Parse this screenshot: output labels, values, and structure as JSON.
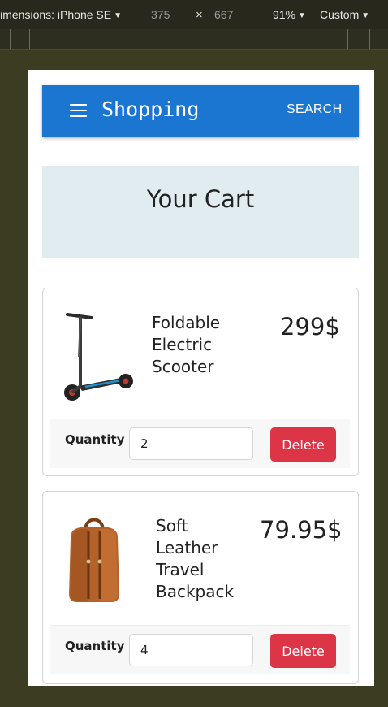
{
  "devtools": {
    "dimensions_label": "Dimensions: iPhone SE",
    "width": "375",
    "times": "×",
    "height": "667",
    "zoom": "91%",
    "mode": "Custom"
  },
  "appbar": {
    "title": "Shopping",
    "search_placeholder": "",
    "search_label": "SEARCH"
  },
  "cart": {
    "heading": "Your Cart",
    "quantity_label": "Quantity",
    "delete_label": "Delete",
    "items": [
      {
        "name": "Foldable Electric Scooter",
        "price": "299$",
        "quantity": "2",
        "image": "electric-scooter"
      },
      {
        "name": "Soft Leather Travel Backpack",
        "price": "79.95$",
        "quantity": "4",
        "image": "leather-backpack"
      }
    ]
  },
  "colors": {
    "appbar": "#1b76d2",
    "banner": "#e1ecf0",
    "delete": "#dc3545",
    "devtools_bg": "#3b3c22"
  }
}
